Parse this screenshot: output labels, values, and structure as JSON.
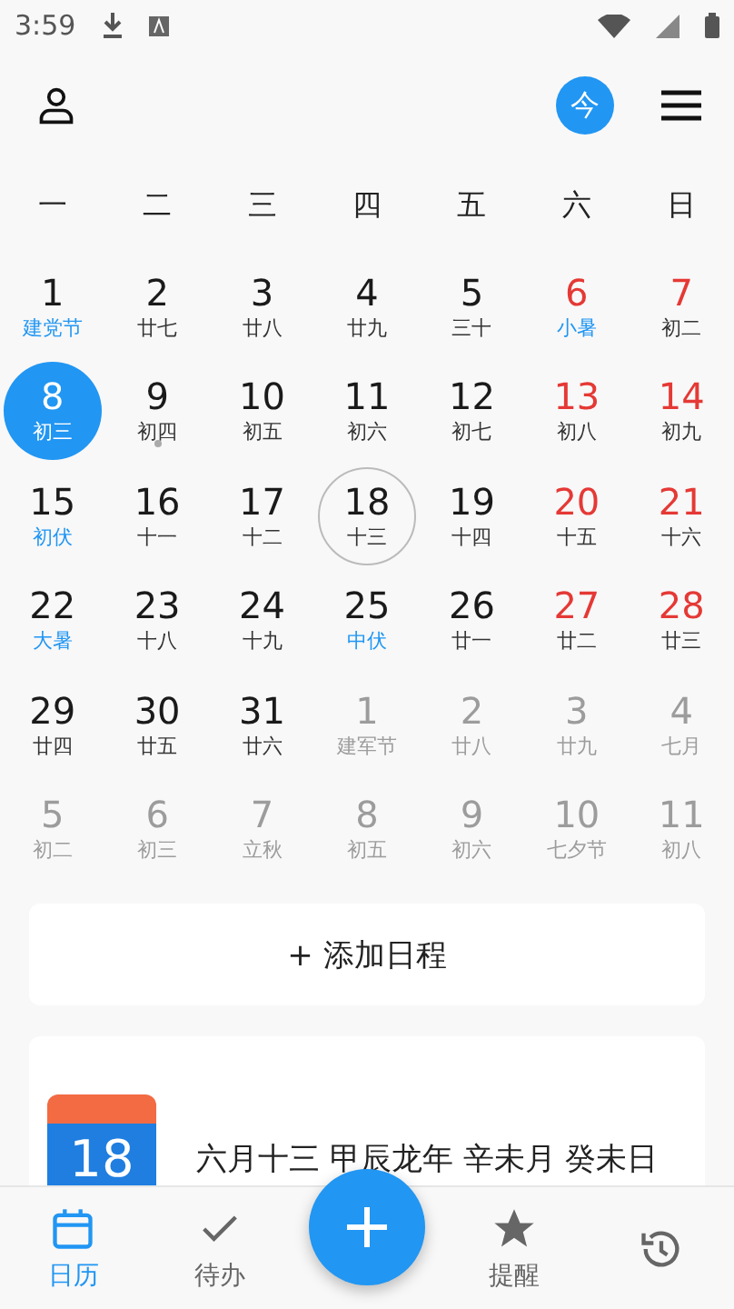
{
  "status_bar": {
    "time": "3:59"
  },
  "header": {
    "today_button": "今"
  },
  "weekdays": [
    "一",
    "二",
    "三",
    "四",
    "五",
    "六",
    "日"
  ],
  "weeks": [
    [
      {
        "day": "1",
        "sub": "建党节",
        "kind": "normal",
        "festival": true,
        "selected": false,
        "ring": false,
        "dot": false
      },
      {
        "day": "2",
        "sub": "廿七",
        "kind": "normal",
        "festival": false,
        "selected": false,
        "ring": false,
        "dot": false
      },
      {
        "day": "3",
        "sub": "廿八",
        "kind": "normal",
        "festival": false,
        "selected": false,
        "ring": false,
        "dot": false
      },
      {
        "day": "4",
        "sub": "廿九",
        "kind": "normal",
        "festival": false,
        "selected": false,
        "ring": false,
        "dot": false
      },
      {
        "day": "5",
        "sub": "三十",
        "kind": "normal",
        "festival": false,
        "selected": false,
        "ring": false,
        "dot": false
      },
      {
        "day": "6",
        "sub": "小暑",
        "kind": "weekend",
        "festival": true,
        "selected": false,
        "ring": false,
        "dot": false
      },
      {
        "day": "7",
        "sub": "初二",
        "kind": "weekend",
        "festival": false,
        "selected": false,
        "ring": false,
        "dot": false
      }
    ],
    [
      {
        "day": "8",
        "sub": "初三",
        "kind": "normal",
        "festival": false,
        "selected": true,
        "ring": false,
        "dot": false
      },
      {
        "day": "9",
        "sub": "初四",
        "kind": "normal",
        "festival": false,
        "selected": false,
        "ring": false,
        "dot": true
      },
      {
        "day": "10",
        "sub": "初五",
        "kind": "normal",
        "festival": false,
        "selected": false,
        "ring": false,
        "dot": false
      },
      {
        "day": "11",
        "sub": "初六",
        "kind": "normal",
        "festival": false,
        "selected": false,
        "ring": false,
        "dot": false
      },
      {
        "day": "12",
        "sub": "初七",
        "kind": "normal",
        "festival": false,
        "selected": false,
        "ring": false,
        "dot": false
      },
      {
        "day": "13",
        "sub": "初八",
        "kind": "weekend",
        "festival": false,
        "selected": false,
        "ring": false,
        "dot": false
      },
      {
        "day": "14",
        "sub": "初九",
        "kind": "weekend",
        "festival": false,
        "selected": false,
        "ring": false,
        "dot": false
      }
    ],
    [
      {
        "day": "15",
        "sub": "初伏",
        "kind": "normal",
        "festival": true,
        "selected": false,
        "ring": false,
        "dot": false
      },
      {
        "day": "16",
        "sub": "十一",
        "kind": "normal",
        "festival": false,
        "selected": false,
        "ring": false,
        "dot": false
      },
      {
        "day": "17",
        "sub": "十二",
        "kind": "normal",
        "festival": false,
        "selected": false,
        "ring": false,
        "dot": false
      },
      {
        "day": "18",
        "sub": "十三",
        "kind": "normal",
        "festival": false,
        "selected": false,
        "ring": true,
        "dot": false
      },
      {
        "day": "19",
        "sub": "十四",
        "kind": "normal",
        "festival": false,
        "selected": false,
        "ring": false,
        "dot": false
      },
      {
        "day": "20",
        "sub": "十五",
        "kind": "weekend",
        "festival": false,
        "selected": false,
        "ring": false,
        "dot": false
      },
      {
        "day": "21",
        "sub": "十六",
        "kind": "weekend",
        "festival": false,
        "selected": false,
        "ring": false,
        "dot": false
      }
    ],
    [
      {
        "day": "22",
        "sub": "大暑",
        "kind": "normal",
        "festival": true,
        "selected": false,
        "ring": false,
        "dot": false
      },
      {
        "day": "23",
        "sub": "十八",
        "kind": "normal",
        "festival": false,
        "selected": false,
        "ring": false,
        "dot": false
      },
      {
        "day": "24",
        "sub": "十九",
        "kind": "normal",
        "festival": false,
        "selected": false,
        "ring": false,
        "dot": false
      },
      {
        "day": "25",
        "sub": "中伏",
        "kind": "normal",
        "festival": true,
        "selected": false,
        "ring": false,
        "dot": false
      },
      {
        "day": "26",
        "sub": "廿一",
        "kind": "normal",
        "festival": false,
        "selected": false,
        "ring": false,
        "dot": false
      },
      {
        "day": "27",
        "sub": "廿二",
        "kind": "weekend",
        "festival": false,
        "selected": false,
        "ring": false,
        "dot": false
      },
      {
        "day": "28",
        "sub": "廿三",
        "kind": "weekend",
        "festival": false,
        "selected": false,
        "ring": false,
        "dot": false
      }
    ],
    [
      {
        "day": "29",
        "sub": "廿四",
        "kind": "normal",
        "festival": false,
        "selected": false,
        "ring": false,
        "dot": false
      },
      {
        "day": "30",
        "sub": "廿五",
        "kind": "normal",
        "festival": false,
        "selected": false,
        "ring": false,
        "dot": false
      },
      {
        "day": "31",
        "sub": "廿六",
        "kind": "normal",
        "festival": false,
        "selected": false,
        "ring": false,
        "dot": false
      },
      {
        "day": "1",
        "sub": "建军节",
        "kind": "faded",
        "festival": false,
        "selected": false,
        "ring": false,
        "dot": false
      },
      {
        "day": "2",
        "sub": "廿八",
        "kind": "faded",
        "festival": false,
        "selected": false,
        "ring": false,
        "dot": false
      },
      {
        "day": "3",
        "sub": "廿九",
        "kind": "faded",
        "festival": false,
        "selected": false,
        "ring": false,
        "dot": false
      },
      {
        "day": "4",
        "sub": "七月",
        "kind": "faded",
        "festival": false,
        "selected": false,
        "ring": false,
        "dot": false
      }
    ],
    [
      {
        "day": "5",
        "sub": "初二",
        "kind": "faded",
        "festival": false,
        "selected": false,
        "ring": false,
        "dot": false
      },
      {
        "day": "6",
        "sub": "初三",
        "kind": "faded",
        "festival": false,
        "selected": false,
        "ring": false,
        "dot": false
      },
      {
        "day": "7",
        "sub": "立秋",
        "kind": "faded",
        "festival": false,
        "selected": false,
        "ring": false,
        "dot": false
      },
      {
        "day": "8",
        "sub": "初五",
        "kind": "faded",
        "festival": false,
        "selected": false,
        "ring": false,
        "dot": false
      },
      {
        "day": "9",
        "sub": "初六",
        "kind": "faded",
        "festival": false,
        "selected": false,
        "ring": false,
        "dot": false
      },
      {
        "day": "10",
        "sub": "七夕节",
        "kind": "faded",
        "festival": false,
        "selected": false,
        "ring": false,
        "dot": false
      },
      {
        "day": "11",
        "sub": "初八",
        "kind": "faded",
        "festival": false,
        "selected": false,
        "ring": false,
        "dot": false
      }
    ]
  ],
  "add_button": "+ 添加日程",
  "info_card": {
    "icon_day": "18",
    "lunar_text": "六月十三 甲辰龙年 辛未月 癸未日"
  },
  "bottom_nav": [
    {
      "label": "日历",
      "kind": "calendar",
      "selected": true
    },
    {
      "label": "待办",
      "kind": "check",
      "selected": false
    },
    {
      "label": "提醒",
      "kind": "star",
      "selected": false
    },
    {
      "kind": "history",
      "selected": false
    }
  ]
}
